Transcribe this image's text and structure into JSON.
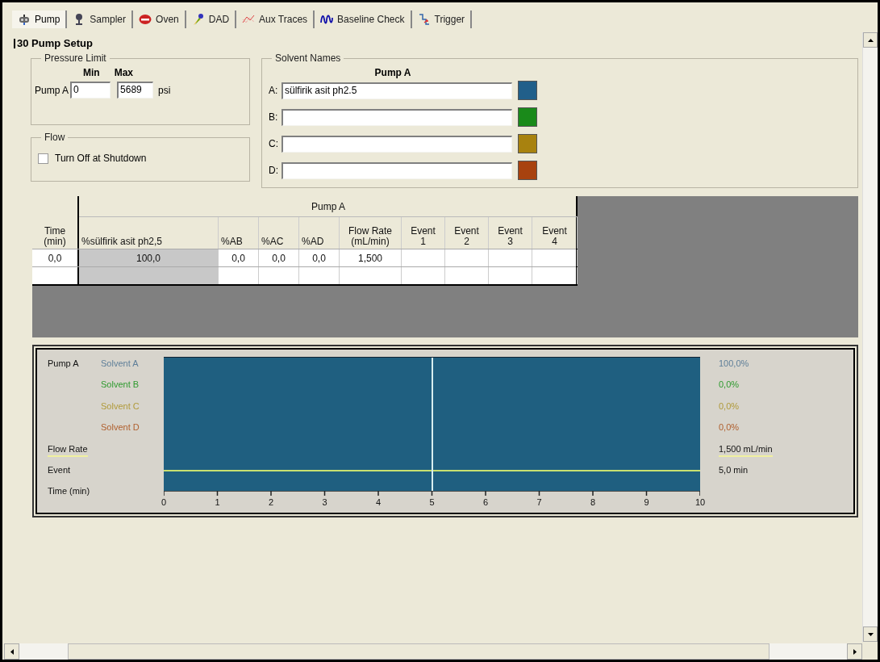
{
  "tabs": [
    {
      "label": "Pump",
      "selected": true
    },
    {
      "label": "Sampler",
      "selected": false
    },
    {
      "label": "Oven",
      "selected": false
    },
    {
      "label": "DAD",
      "selected": false
    },
    {
      "label": "Aux Traces",
      "selected": false
    },
    {
      "label": "Baseline Check",
      "selected": false
    },
    {
      "label": "Trigger",
      "selected": false
    }
  ],
  "title": "30 Pump Setup",
  "pressure_limit": {
    "label": "Pressure Limit",
    "min_header": "Min",
    "max_header": "Max",
    "pump_label": "Pump A",
    "min": "0",
    "max": "5689",
    "unit": "psi"
  },
  "flow": {
    "label": "Flow",
    "checkbox": {
      "label": "Turn Off at Shutdown",
      "checked": false
    }
  },
  "solvent_names": {
    "label": "Solvent Names",
    "header": "Pump A",
    "solvents": [
      {
        "letter": "A:",
        "value": "sülfirik asit ph2.5",
        "color": "#215f8a"
      },
      {
        "letter": "B:",
        "color": "#1a8a1a"
      },
      {
        "letter": "C:",
        "color": "#a8820f"
      },
      {
        "letter": "D:",
        "color": "#a8420f"
      }
    ]
  },
  "table": {
    "group_header": "Pump A",
    "columns": [
      {
        "lines": [
          "Time",
          "(min)"
        ]
      },
      {
        "lines": [
          "%sülfirik asit ph2,5"
        ],
        "readonly": true
      },
      {
        "lines": [
          "%AB"
        ]
      },
      {
        "lines": [
          "%AC"
        ]
      },
      {
        "lines": [
          "%AD"
        ]
      },
      {
        "lines": [
          "Flow Rate",
          "(mL/min)"
        ]
      },
      {
        "lines": [
          "Event",
          "1"
        ]
      },
      {
        "lines": [
          "Event",
          "2"
        ]
      },
      {
        "lines": [
          "Event",
          "3"
        ]
      },
      {
        "lines": [
          "Event",
          "4"
        ]
      }
    ],
    "rows": [
      {
        "cells": [
          "0,0",
          "100,0",
          "0,0",
          "0,0",
          "0,0",
          "1,500"
        ]
      }
    ]
  },
  "chart": {
    "group_label": "Pump A",
    "rows": [
      {
        "kind": "solvent",
        "label": "Solvent A",
        "color": "#5f7f99",
        "reading": "100,0%"
      },
      {
        "kind": "solvent",
        "label": "Solvent B",
        "color": "#2f9a2f",
        "reading": "0,0%"
      },
      {
        "kind": "solvent",
        "label": "Solvent C",
        "color": "#b09a3a",
        "reading": "0,0%"
      },
      {
        "kind": "solvent",
        "label": "Solvent D",
        "color": "#b0602f",
        "reading": "0,0%"
      },
      {
        "kind": "flow",
        "label": "Flow Rate",
        "reading": "1,500 mL/min"
      },
      {
        "kind": "event",
        "label": "Event",
        "reading": "5,0 min"
      }
    ],
    "time_label": "Time (min)",
    "time_ticks": [
      "0",
      "1",
      "2",
      "3",
      "4",
      "5",
      "6",
      "7",
      "8",
      "9",
      "10"
    ],
    "cursor": {
      "level": 0.5
    }
  }
}
